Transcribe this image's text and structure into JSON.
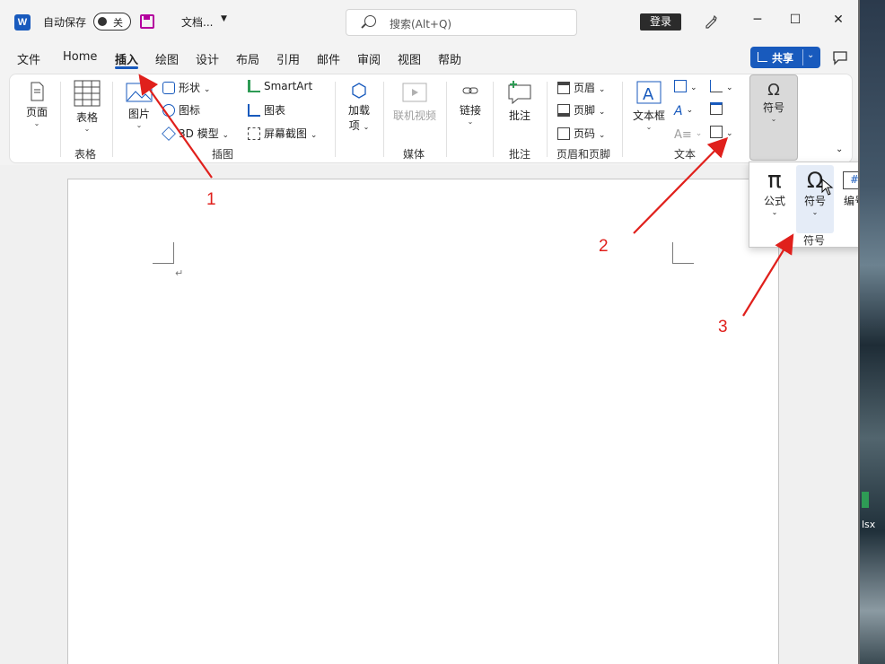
{
  "titlebar": {
    "autosave_label": "自动保存",
    "autosave_state": "关",
    "doc_name": "文档...",
    "search_placeholder": "搜索(Alt+Q)",
    "login": "登录",
    "minimize": "─",
    "maximize": "☐",
    "close": "✕"
  },
  "tabs": [
    "文件",
    "Home",
    "插入",
    "绘图",
    "设计",
    "布局",
    "引用",
    "邮件",
    "审阅",
    "视图",
    "帮助"
  ],
  "active_tab": "插入",
  "share": "共享",
  "ribbon": {
    "page": "页面",
    "table": "表格",
    "table_group": "表格",
    "picture": "图片",
    "shapes": "形状",
    "icons": "图标",
    "model3d": "3D 模型",
    "smartart": "SmartArt",
    "chart": "图表",
    "screenshot": "屏幕截图",
    "illus_group": "插图",
    "addins": "加载",
    "addins2": "项",
    "online_video": "联机视频",
    "media_group": "媒体",
    "link": "链接",
    "comment": "批注",
    "comment_group": "批注",
    "header": "页眉",
    "footer": "页脚",
    "page_number": "页码",
    "hf_group": "页眉和页脚",
    "textbox": "文本框",
    "text_group": "文本",
    "symbols": "符号"
  },
  "flyout": {
    "equation": "公式",
    "symbol": "符号",
    "number": "编号",
    "group": "符号"
  },
  "desktop_label": "lsx",
  "annotations": [
    "1",
    "2",
    "3"
  ],
  "colors": {
    "accent": "#185abd",
    "annotation": "#e0201c"
  }
}
